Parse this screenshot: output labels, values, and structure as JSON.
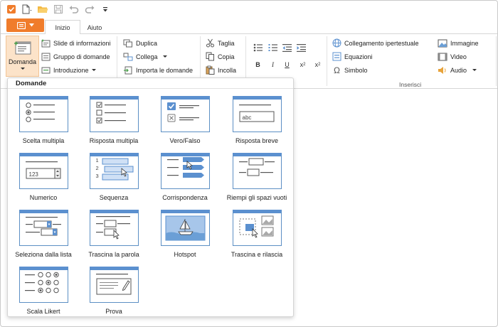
{
  "colors": {
    "accent": "#f07c2b",
    "thumb_blue": "#5b90cf",
    "selected_bg": "#fce3c9"
  },
  "quick_access": [
    "app-icon",
    "new-file-icon",
    "open-folder-icon",
    "save-icon",
    "undo-icon",
    "redo-icon",
    "more-icon"
  ],
  "tabs": {
    "start": "Inizio",
    "help": "Aiuto"
  },
  "ribbon": {
    "question_button": "Domanda",
    "slide_info": "Slide di informazioni",
    "question_group": "Gruppo di domande",
    "intro": "Introduzione",
    "duplicate": "Duplica",
    "link": "Collega",
    "import_questions": "Importa le domande",
    "cut": "Taglia",
    "copy": "Copia",
    "paste": "Incolla",
    "bold": "B",
    "italic": "I",
    "underline": "U",
    "subscript": "x",
    "subscript_sub": "2",
    "superscript": "x",
    "superscript_sup": "2",
    "hyperlink": "Collegamento ipertestuale",
    "equations": "Equazioni",
    "symbol": "Simbolo",
    "image": "Immagine",
    "video": "Video",
    "audio": "Audio",
    "insert_group": "Inserisci"
  },
  "panel": {
    "title": "Domande",
    "items": [
      "Scelta multipla",
      "Risposta multipla",
      "Vero/Falso",
      "Risposta breve",
      "Numerico",
      "Sequenza",
      "Corrispondenza",
      "Riempi gli spazi vuoti",
      "Seleziona dalla lista",
      "Trascina la parola",
      "Hotspot",
      "Trascina e rilascia",
      "Scala Likert",
      "Prova"
    ],
    "short_answer_placeholder": "abc",
    "numeric_value": "123",
    "sequence_numbers": [
      "1",
      "2",
      "3"
    ]
  }
}
